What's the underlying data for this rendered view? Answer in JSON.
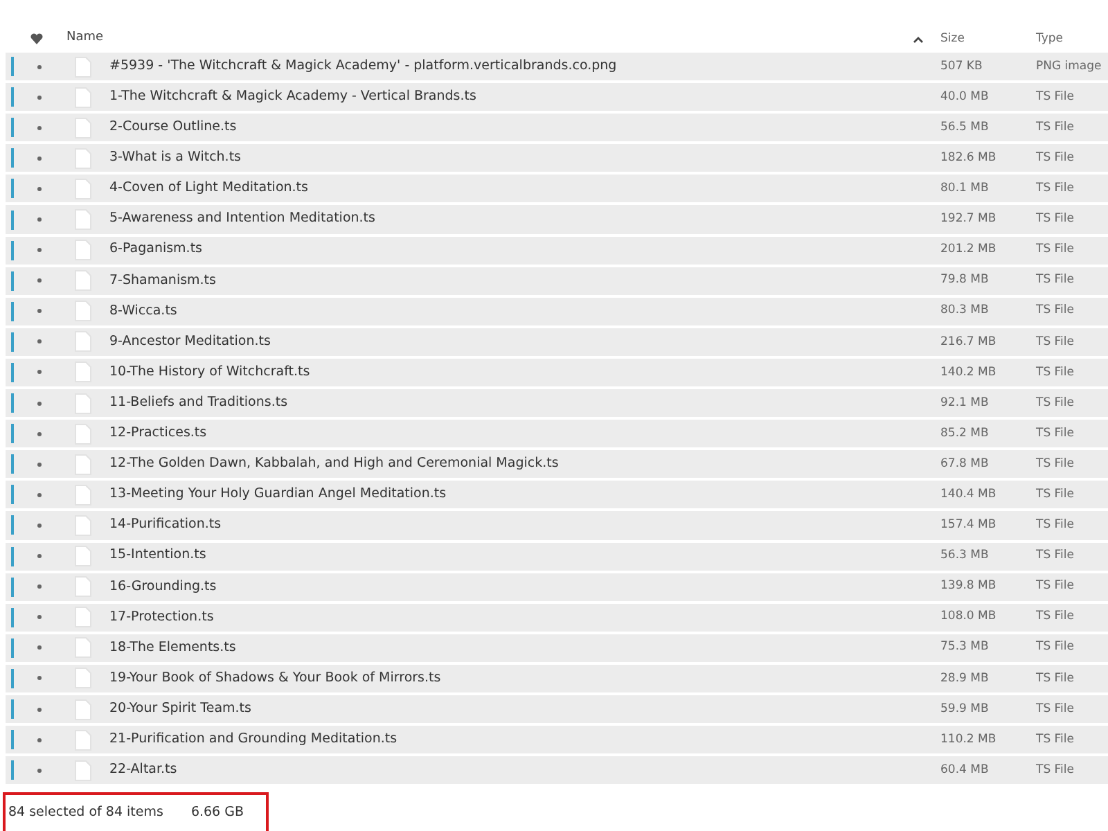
{
  "table": {
    "columns": [
      {
        "label": "Name",
        "sorted": true
      },
      {
        "label": "Size",
        "sorted": false
      },
      {
        "label": "Type",
        "sorted": false
      }
    ],
    "rows": [
      {
        "name": "#5939 - 'The Witchcraft & Magick Academy' - platform.verticalbrands.co.png",
        "size": "507 KB",
        "type": "PNG image",
        "selected": true
      },
      {
        "name": "1-The Witchcraft & Magick Academy - Vertical Brands.ts",
        "size": "40.0 MB",
        "type": "TS File",
        "selected": true
      },
      {
        "name": "2-Course Outline.ts",
        "size": "56.5 MB",
        "type": "TS File",
        "selected": true
      },
      {
        "name": "3-What is a Witch.ts",
        "size": "182.6 MB",
        "type": "TS File",
        "selected": true
      },
      {
        "name": "4-Coven of Light Meditation.ts",
        "size": "80.1 MB",
        "type": "TS File",
        "selected": true
      },
      {
        "name": "5-Awareness and Intention Meditation.ts",
        "size": "192.7 MB",
        "type": "TS File",
        "selected": true
      },
      {
        "name": "6-Paganism.ts",
        "size": "201.2 MB",
        "type": "TS File",
        "selected": true
      },
      {
        "name": "7-Shamanism.ts",
        "size": "79.8 MB",
        "type": "TS File",
        "selected": true
      },
      {
        "name": "8-Wicca.ts",
        "size": "80.3 MB",
        "type": "TS File",
        "selected": true
      },
      {
        "name": "9-Ancestor Meditation.ts",
        "size": "216.7 MB",
        "type": "TS File",
        "selected": true
      },
      {
        "name": "10-The History of Witchcraft.ts",
        "size": "140.2 MB",
        "type": "TS File",
        "selected": true
      },
      {
        "name": "11-Beliefs and Traditions.ts",
        "size": "92.1 MB",
        "type": "TS File",
        "selected": true
      },
      {
        "name": "12-Practices.ts",
        "size": "85.2 MB",
        "type": "TS File",
        "selected": true
      },
      {
        "name": "12-The Golden Dawn, Kabbalah, and High and Ceremonial Magick.ts",
        "size": "67.8 MB",
        "type": "TS File",
        "selected": true
      },
      {
        "name": "13-Meeting Your Holy Guardian Angel Meditation.ts",
        "size": "140.4 MB",
        "type": "TS File",
        "selected": true
      },
      {
        "name": "14-Purification.ts",
        "size": "157.4 MB",
        "type": "TS File",
        "selected": true
      },
      {
        "name": "15-Intention.ts",
        "size": "56.3 MB",
        "type": "TS File",
        "selected": true
      },
      {
        "name": "16-Grounding.ts",
        "size": "139.8 MB",
        "type": "TS File",
        "selected": true
      },
      {
        "name": "17-Protection.ts",
        "size": "108.0 MB",
        "type": "TS File",
        "selected": true
      },
      {
        "name": "18-The Elements.ts",
        "size": "75.3 MB",
        "type": "TS File",
        "selected": true
      },
      {
        "name": "19-Your Book of Shadows & Your Book of Mirrors.ts",
        "size": "28.9 MB",
        "type": "TS File",
        "selected": true
      },
      {
        "name": "20-Your Spirit Team.ts",
        "size": "59.9 MB",
        "type": "TS File",
        "selected": true
      },
      {
        "name": "21-Purification and Grounding Meditation.ts",
        "size": "110.2 MB",
        "type": "TS File",
        "selected": true
      },
      {
        "name": "22-Altar.ts",
        "size": "60.4 MB",
        "type": "TS File",
        "selected": true
      }
    ]
  },
  "status_bar": {
    "selection": "84 selected of 84 items",
    "total_size": "6.66 GB",
    "highlighted": true
  }
}
